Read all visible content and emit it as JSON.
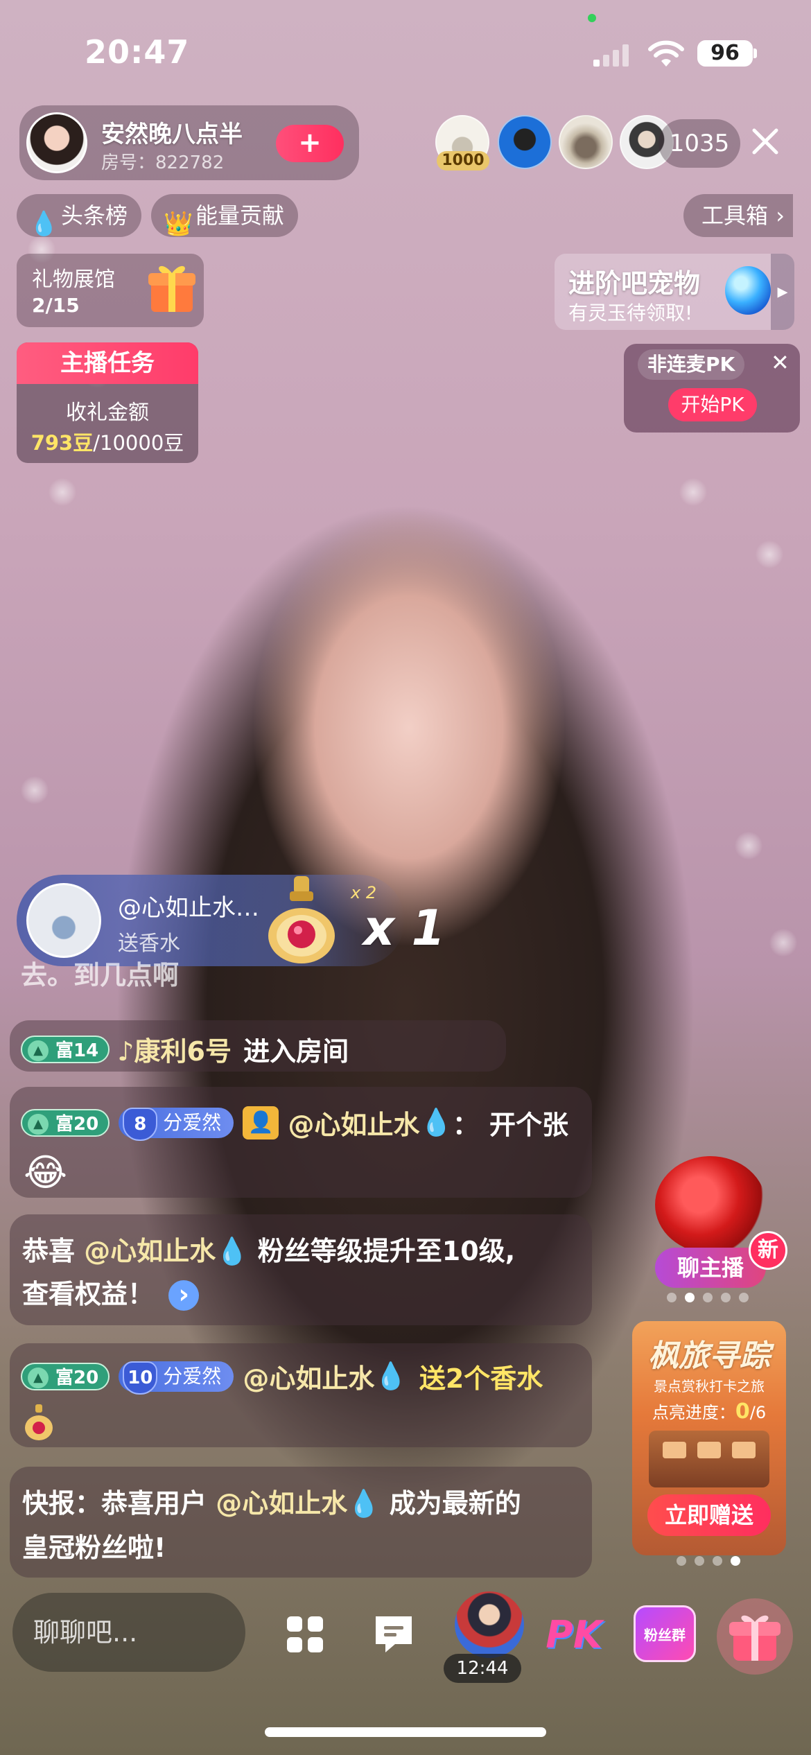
{
  "status_bar": {
    "time": "20:47",
    "battery": "96"
  },
  "host": {
    "name": "安然晚八点半",
    "room_id": "房号：822782",
    "follow_symbol": "+"
  },
  "viewers": {
    "first_badge": "1000",
    "count": "1035"
  },
  "top_pills": {
    "headline": "头条榜",
    "energy": "能量贡献",
    "toolbox": "工具箱"
  },
  "gift_hall": {
    "title": "礼物展馆",
    "progress": "2/15"
  },
  "host_task": {
    "title": "主播任务",
    "label": "收礼金额",
    "current": "793豆",
    "target": "/10000豆"
  },
  "pet_banner": {
    "title": "进阶吧宠物",
    "subtitle": "有灵玉待领取!"
  },
  "pk_card": {
    "title": "非连麦PK",
    "button": "开始PK"
  },
  "gift_toast": {
    "user": "@心如止水…",
    "action": "送香水",
    "small_count": "x 2",
    "count": "x 1"
  },
  "chat": {
    "partial": "去。到几点啊",
    "enter": {
      "level": "富14",
      "user": "♪康利6号",
      "text": "进入房间"
    },
    "msg1": {
      "level": "富20",
      "fan_level": "8",
      "fan_name": "分爱然",
      "user": "@心如止水",
      "sep": "：",
      "text": "开个张",
      "emoji": "😂"
    },
    "msg2": {
      "line1_a": "恭喜 ",
      "user": "@心如止水",
      "line1_b": " 粉丝等级提升至10级,",
      "line2": "查看权益！",
      "arrow": "›"
    },
    "msg3": {
      "level": "富20",
      "fan_level": "10",
      "fan_name": "分爱然",
      "user": "@心如止水",
      "text": "送2个香水"
    },
    "msg4": {
      "line1_a": "快报：恭喜用户 ",
      "user": "@心如止水",
      "line1_b": " 成为最新的",
      "line2": "皇冠粉丝啦!"
    }
  },
  "side": {
    "talk_host": "聊主播",
    "new_badge": "新",
    "maple_title": "枫旅寻踪",
    "maple_sub": "景点赏秋打卡之旅",
    "maple_progress_label": "点亮进度：",
    "maple_progress": "0",
    "maple_total": "/6",
    "maple_button": "立即赠送"
  },
  "bottom_bar": {
    "input_placeholder": "聊聊吧...",
    "pk_label": "PK",
    "fan_club_label": "粉丝群",
    "timer": "12:44"
  }
}
